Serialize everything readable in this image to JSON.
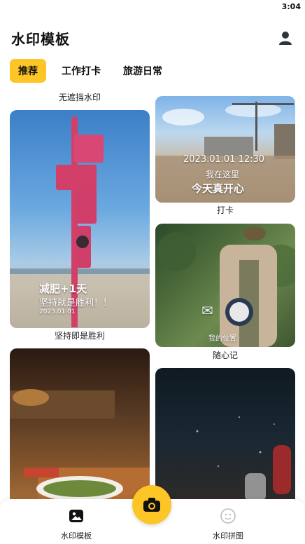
{
  "status": {
    "time": "3:04"
  },
  "header": {
    "title": "水印模板"
  },
  "tabs": [
    {
      "label": "推荐",
      "active": true
    },
    {
      "label": "工作打卡",
      "active": false
    },
    {
      "label": "旅游日常",
      "active": false
    }
  ],
  "cards": {
    "top_left_label": "无遮挡水印",
    "sign": {
      "line1": "减肥+1天",
      "line2": "坚持就是胜利！！",
      "date": "2023.01.01",
      "caption": "坚持即是胜利"
    },
    "site": {
      "datetime": "2023.01.01 12:30",
      "location": "我在这里",
      "slogan": "今天真开心",
      "caption": "打卡"
    },
    "forest": {
      "location": "我的位置",
      "caption": "随心记"
    }
  },
  "bottom_nav": {
    "left_label": "水印模板",
    "right_label": "水印拼图"
  },
  "colors": {
    "accent": "#fdc626"
  }
}
